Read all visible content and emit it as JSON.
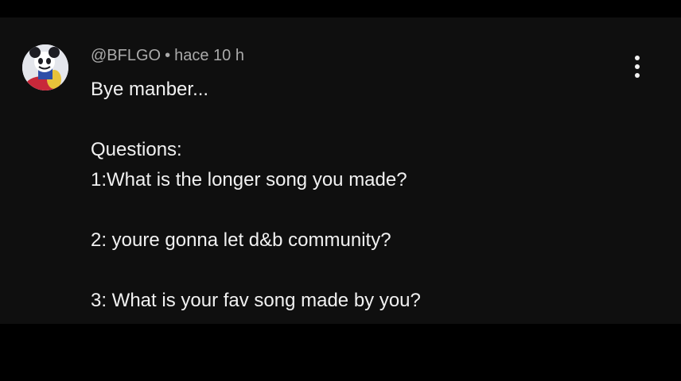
{
  "comment": {
    "author": "@BFLGO",
    "separator": "•",
    "timestamp": "hace 10 h",
    "lines": [
      "Bye manber...",
      "",
      "Questions:",
      "1:What is the longer song you made?",
      "",
      "2: youre gonna let d&b community?",
      "",
      "3: What is your fav song made by you?"
    ],
    "menu_icon": "more-vertical-icon",
    "avatar_icon": "cartoon-character-avatar"
  },
  "colors": {
    "panel_background": "#0f0f0f",
    "letterbox": "#000000",
    "primary_text": "#f1f1f1",
    "secondary_text": "#aaaaaa"
  }
}
